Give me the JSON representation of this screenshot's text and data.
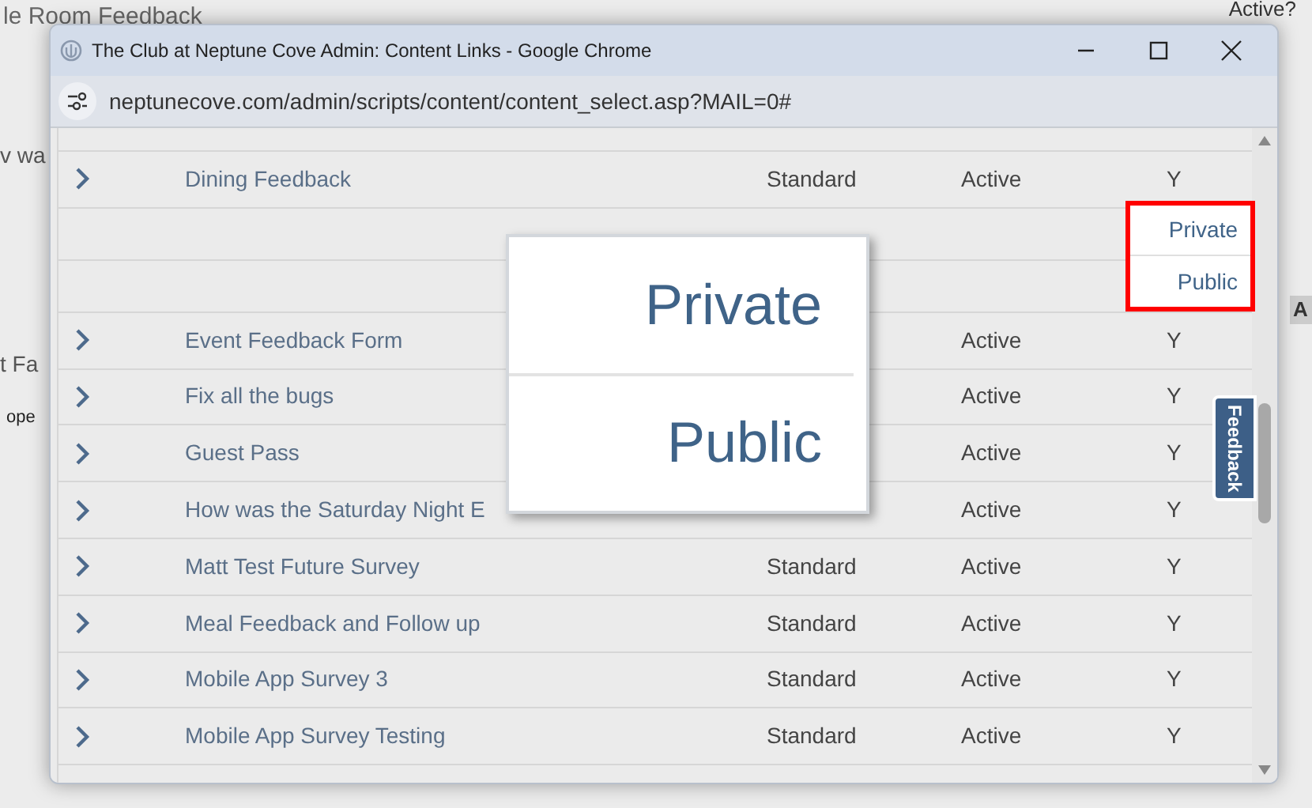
{
  "background_page": {
    "heading": "le Room Feedback",
    "column_header": "Active?",
    "fragments": [
      "v wa",
      "t Fa",
      "ope"
    ],
    "side_button": "A"
  },
  "window": {
    "title": "The Club at Neptune Cove Admin: Content Links - Google Chrome",
    "url": "neptunecove.com/admin/scripts/content/content_select.asp?MAIL=0#"
  },
  "table": {
    "rows": [
      {
        "kind": "item",
        "name": "Dining Feedback",
        "type": "Standard",
        "status": "Active",
        "flag": "Y"
      },
      {
        "kind": "option",
        "label": "Private"
      },
      {
        "kind": "option",
        "label": "Public"
      },
      {
        "kind": "item",
        "name": "Event Feedback Form",
        "status": "Active",
        "flag": "Y"
      },
      {
        "kind": "item",
        "name": "Fix all the bugs",
        "status": "Active",
        "flag": "Y"
      },
      {
        "kind": "item",
        "name": "Guest Pass",
        "status": "Active",
        "flag": "Y"
      },
      {
        "kind": "item",
        "name": "How was the Saturday Night E",
        "status": "Active",
        "flag": "Y"
      },
      {
        "kind": "item",
        "name": "Matt Test Future Survey",
        "type": "Standard",
        "status": "Active",
        "flag": "Y"
      },
      {
        "kind": "item",
        "name": "Meal Feedback and Follow up",
        "type": "Standard",
        "status": "Active",
        "flag": "Y"
      },
      {
        "kind": "item",
        "name": "Mobile App Survey 3",
        "type": "Standard",
        "status": "Active",
        "flag": "Y"
      },
      {
        "kind": "item",
        "name": "Mobile App Survey Testing",
        "type": "Standard",
        "status": "Active",
        "flag": "Y"
      }
    ]
  },
  "zoom_popup": {
    "items": [
      "Private",
      "Public"
    ]
  },
  "feedback_tab": "Feedback"
}
